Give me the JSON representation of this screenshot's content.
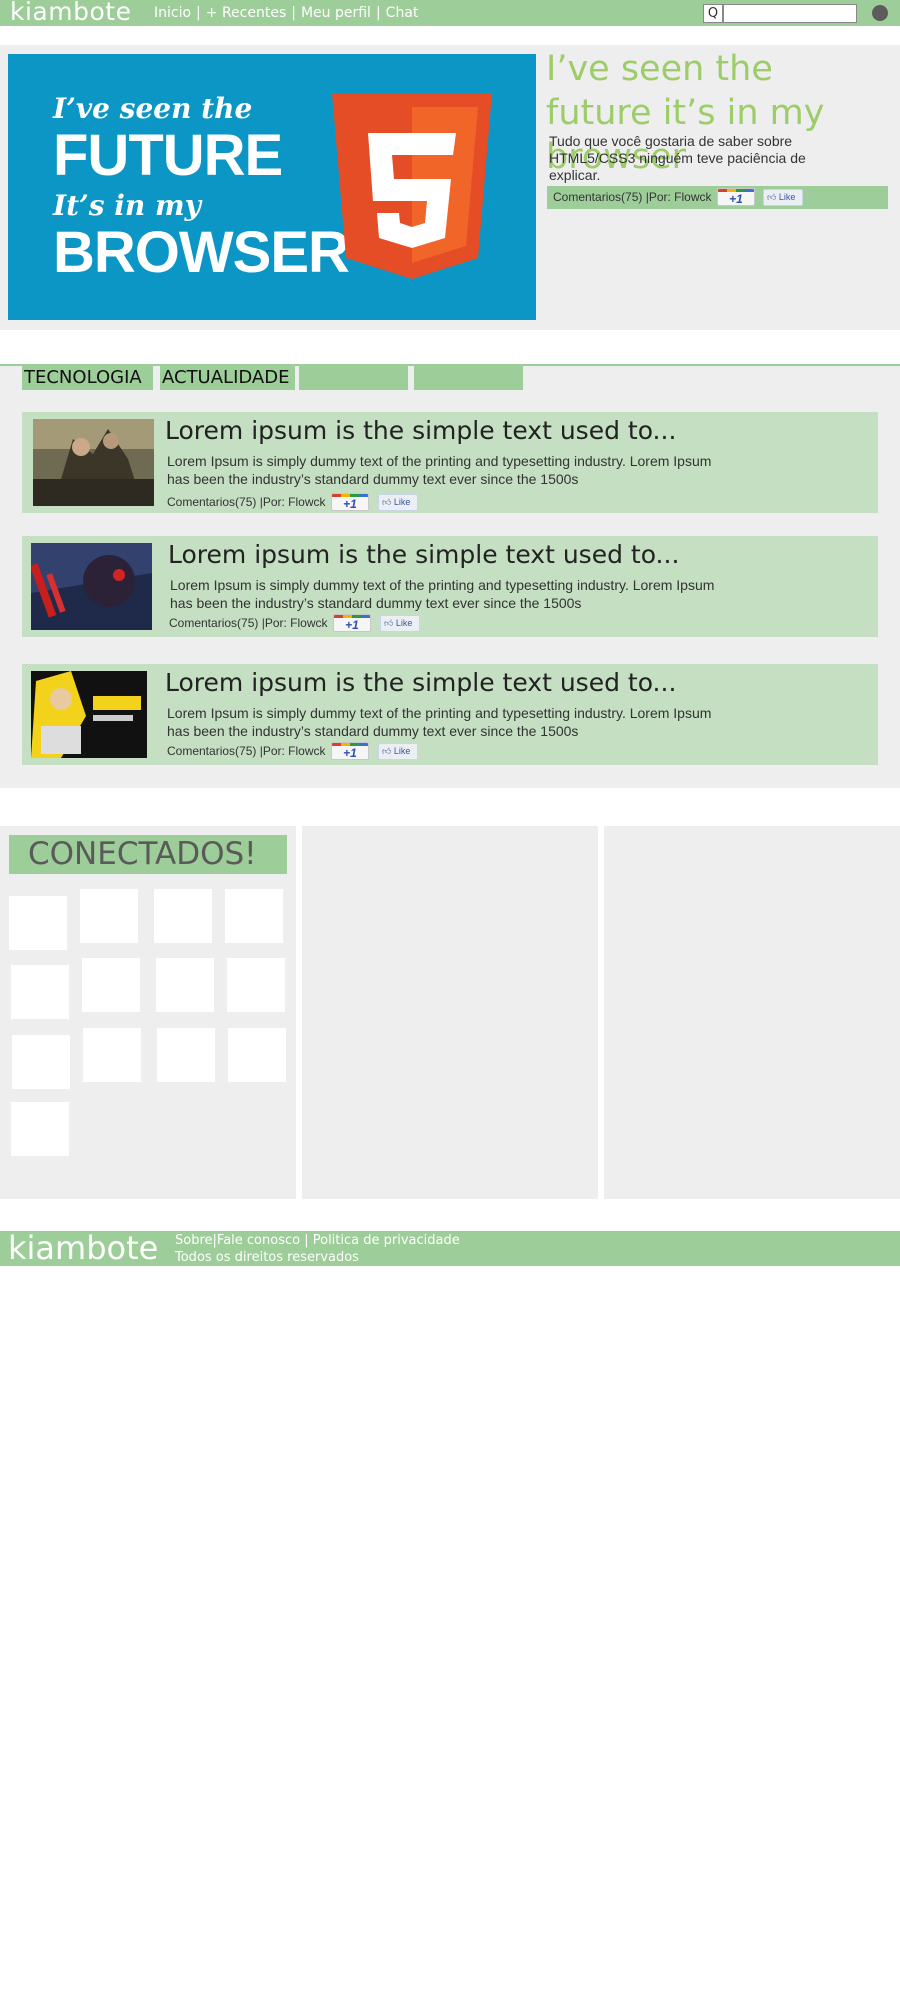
{
  "header": {
    "logo": "kiambote",
    "nav": [
      {
        "label": "Inicio"
      },
      {
        "label": "+ Recentes"
      },
      {
        "label": "Meu perfil"
      },
      {
        "label": "Chat"
      }
    ],
    "nav_separator": "|",
    "search_icon_glyph": "Q",
    "search_value": "",
    "profile_icon": "user-dot-icon"
  },
  "featured": {
    "image_text": {
      "line1": "I’ve seen the",
      "line2": "FUTURE",
      "line3": "It’s in my",
      "line4": "BROWSER"
    },
    "badge_number": "5",
    "title": "I’ve seen the future it’s in my browser",
    "description": "Tudo que você gostaria de saber sobre HTML5/CSS3 ninguém teve paciência de explicar.",
    "meta": "Comentarios(75) |Por: Flowck"
  },
  "social": {
    "gplus_label": "+1",
    "like_label": "Like"
  },
  "categories": [
    {
      "label": "TECNOLOGIA"
    },
    {
      "label": "ACTUALIDADE"
    },
    {
      "label": ""
    },
    {
      "label": ""
    }
  ],
  "posts": [
    {
      "title": "Lorem ipsum is the simple text used to...",
      "description": "Lorem Ipsum is simply dummy text of the printing and typesetting industry. Lorem Ipsum has been the industry’s standard dummy text ever since the 1500s",
      "meta": "Comentarios(75) |Por: Flowck"
    },
    {
      "title": "Lorem ipsum is the simple text used to...",
      "description": "Lorem Ipsum is simply dummy text of the printing and typesetting industry. Lorem Ipsum has been the industry’s standard dummy text ever since the 1500s",
      "meta": "Comentarios(75) |Por: Flowck"
    },
    {
      "title": "Lorem ipsum is the simple text used to...",
      "description": "Lorem Ipsum is simply dummy text of the printing and typesetting industry. Lorem Ipsum has been the industry’s standard dummy text ever since the 1500s",
      "meta": "Comentarios(75) |Por: Flowck"
    }
  ],
  "sidebar": {
    "title": "CONECTADOS!",
    "avatar_count": 13
  },
  "footer": {
    "logo": "kiambote",
    "links": [
      {
        "label": "Sobre"
      },
      {
        "label": "Fale conosco"
      },
      {
        "label": "Politica de privacidade"
      }
    ],
    "copyright": "Todos os direitos reservados"
  },
  "colors": {
    "brand_green": "#9dcd98",
    "post_green": "#c4dfc2",
    "title_green": "#9dcd6a",
    "panel_gray": "#eeeeee",
    "hero_blue": "#0b96c6",
    "html5_orange": "#e44d26"
  }
}
